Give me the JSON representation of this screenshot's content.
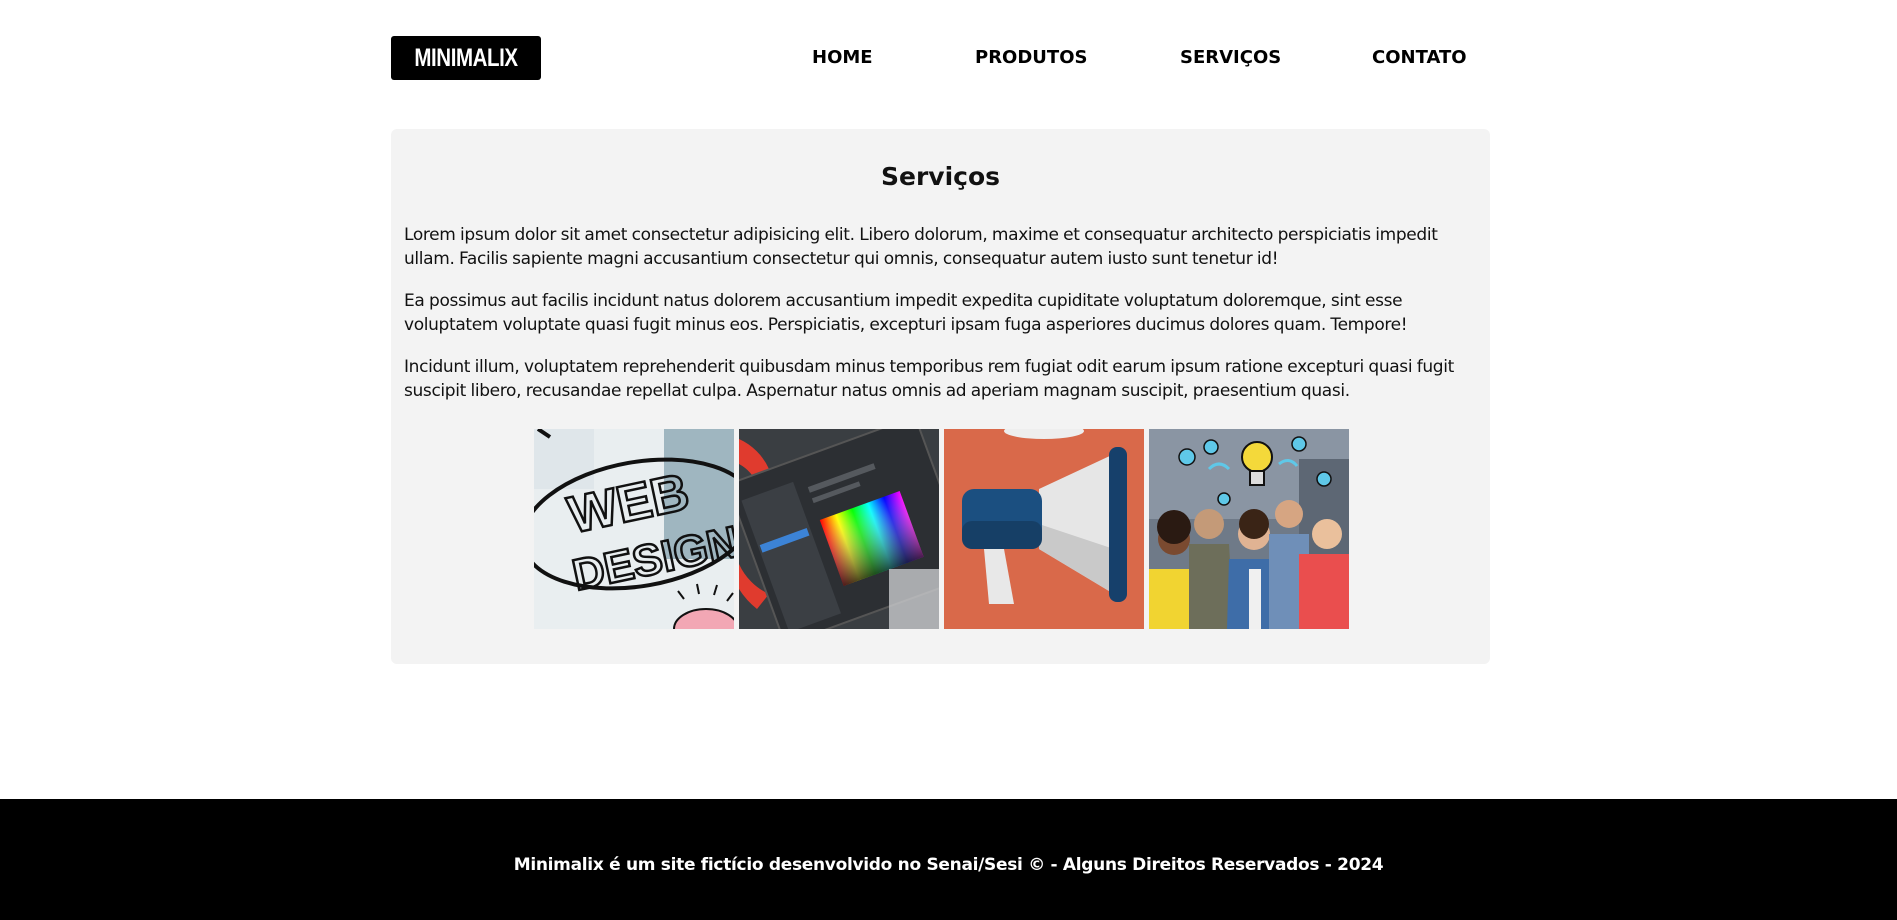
{
  "header": {
    "logo": "MINIMALIX",
    "nav": [
      {
        "label": "HOME"
      },
      {
        "label": "PRODUTOS"
      },
      {
        "label": "SERVIÇOS"
      },
      {
        "label": "CONTATO"
      }
    ]
  },
  "main": {
    "title": "Serviços",
    "paragraphs": [
      "Lorem ipsum dolor sit amet consectetur adipisicing elit. Libero dolorum, maxime et consequatur architecto perspiciatis impedit ullam. Facilis sapiente magni accusantium consectetur qui omnis, consequatur autem iusto sunt tenetur id!",
      "Ea possimus aut facilis incidunt natus dolorem accusantium impedit expedita cupiditate voluptatum doloremque, sint esse voluptatem voluptate quasi fugit minus eos. Perspiciatis, excepturi ipsam fuga asperiores ducimus dolores quam. Tempore!",
      "Incidunt illum, voluptatem reprehenderit quibusdam minus temporibus rem fugiat odit earum ipsum ratione excepturi quasi fugit suscipit libero, recusandae repellat culpa. Aspernatur natus omnis ad aperiam magnam suscipit, praesentium quasi."
    ],
    "gallery": [
      {
        "icon": "web-design-image",
        "text_line1": "WEB",
        "text_line2": "DESIGN"
      },
      {
        "icon": "color-picker-software-image"
      },
      {
        "icon": "megaphone-image"
      },
      {
        "icon": "team-ideas-image"
      }
    ]
  },
  "footer": {
    "text": "Minimalix é um site fictício desenvolvido no Senai/Sesi © - Alguns Direitos Reservados - 2024"
  }
}
